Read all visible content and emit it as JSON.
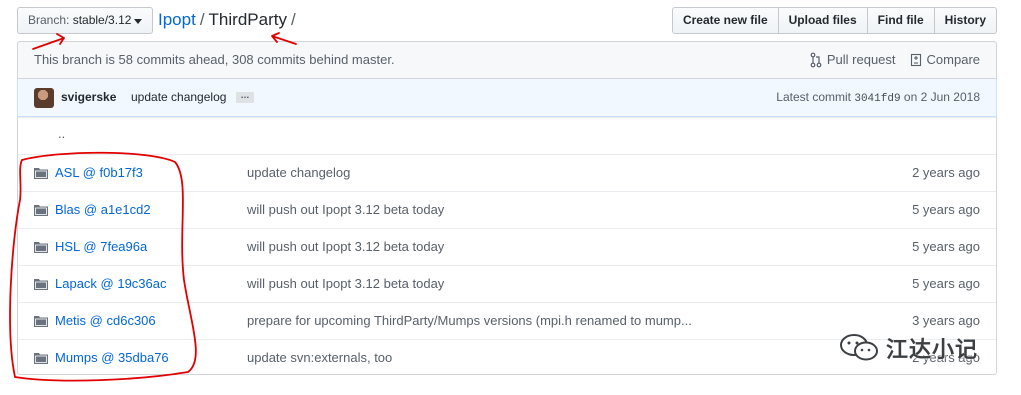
{
  "branch": {
    "label": "Branch:",
    "name": "stable/3.12"
  },
  "breadcrumb": {
    "repo": "Ipopt",
    "separator": "/",
    "current": "ThirdParty",
    "trailing": "/"
  },
  "file_nav": {
    "create": "Create new file",
    "upload": "Upload files",
    "find": "Find file",
    "history": "History"
  },
  "branch_info": {
    "text": "This branch is 58 commits ahead, 308 commits behind master.",
    "pull_request": "Pull request",
    "compare": "Compare"
  },
  "commit": {
    "author": "svigerske",
    "message": "update changelog",
    "ellipsis": "…",
    "latest_label": "Latest commit",
    "sha": "3041fd9",
    "date_prefix": "on",
    "date": "2 Jun 2018"
  },
  "up_dir": "..",
  "files": [
    {
      "name": "ASL @ f0b17f3",
      "message": "update changelog",
      "age": "2 years ago"
    },
    {
      "name": "Blas @ a1e1cd2",
      "message": "will push out Ipopt 3.12 beta today",
      "age": "5 years ago"
    },
    {
      "name": "HSL @ 7fea96a",
      "message": "will push out Ipopt 3.12 beta today",
      "age": "5 years ago"
    },
    {
      "name": "Lapack @ 19c36ac",
      "message": "will push out Ipopt 3.12 beta today",
      "age": "5 years ago"
    },
    {
      "name": "Metis @ cd6c306",
      "message": "prepare for upcoming ThirdParty/Mumps versions (mpi.h renamed to mump...",
      "age": "3 years ago"
    },
    {
      "name": "Mumps @ 35dba76",
      "message": "update svn:externals, too",
      "age": "2 years ago"
    }
  ],
  "watermark": {
    "text": "江达小记"
  },
  "colors": {
    "link": "#0366d6",
    "annotation": "#e00000",
    "folder_icon": "#6a737d"
  }
}
